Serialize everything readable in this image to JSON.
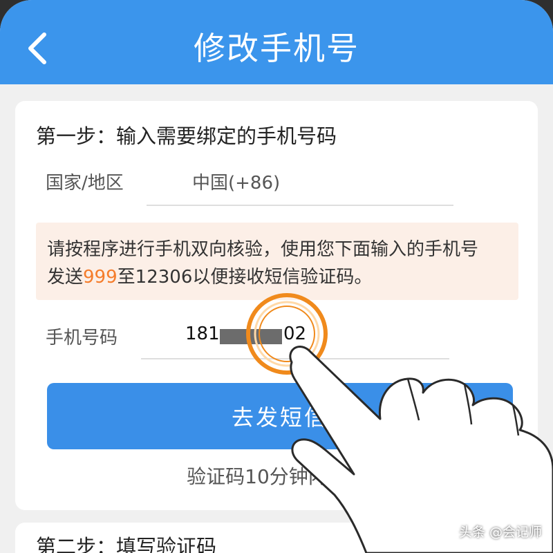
{
  "header": {
    "title": "修改手机号",
    "back_icon": "chevron-left-icon"
  },
  "step1": {
    "title": "第一步：输入需要绑定的手机号码",
    "country_label": "国家/地区",
    "country_value": "中国(+86)",
    "notice": {
      "line1": "请按程序进行手机双向核验，使用您下面输入的手机号",
      "line2_prefix": "发送",
      "line2_code": "999",
      "line2_suffix": "至12306以便接收短信验证码。"
    },
    "phone_label": "手机号码",
    "phone_prefix": "181",
    "phone_suffix": "02",
    "send_button": "去发短信",
    "validity_note": "验证码10分钟内有效"
  },
  "step2": {
    "title": "第二步：填写验证码"
  },
  "watermark": "头条 @会记师",
  "colors": {
    "header_bg": "#3b95ec",
    "button_bg": "#3a8fe8",
    "notice_bg": "#fcefe7",
    "highlight": "#f57c2a",
    "tap_ring": "#f08a1c"
  }
}
